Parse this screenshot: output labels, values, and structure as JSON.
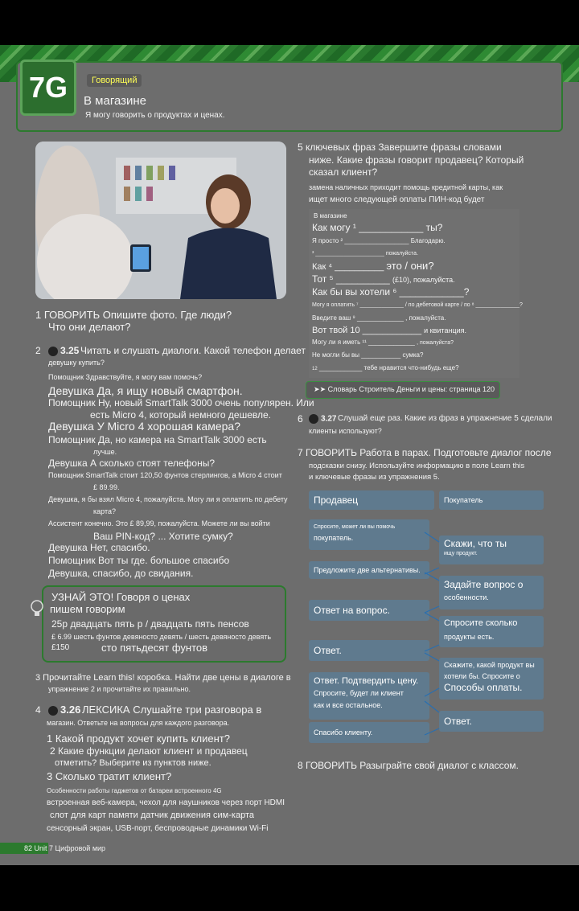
{
  "header": {
    "unit_tag": "7G",
    "speaking_tag": "Говорящий",
    "title": "В магазине",
    "subtitle": "Я могу говорить о продуктах и ценах."
  },
  "colors": {
    "green": "#2c7a2e",
    "box": "#5f7a8e",
    "yellow": "#ffff55"
  },
  "ex1": {
    "label": "1 ГОВОРИТЬ Опишите фото. Где люди?",
    "line2": "Что они делают?"
  },
  "ex2": {
    "label": "2",
    "audio": "3.25",
    "text": "Читать и слушать диалоги. Какой телефон делает",
    "line2": "девушку купить?",
    "dialogue": [
      {
        "text": "Помощник Здравствуйте, я могу вам помочь?",
        "size": "s"
      },
      {
        "text": "Девушка Да, я ищу новый смартфон.",
        "size": "b"
      },
      {
        "text": "Помощник Ну, новый SmartTalk 3000 очень популярен. Или",
        "size": "t"
      },
      {
        "text": "есть Micro 4, который немного дешевле.",
        "size": "t"
      },
      {
        "text": "Девушка У Micro 4 хорошая камера?",
        "size": "b"
      },
      {
        "text": "Помощник Да, но камера на SmartTalk 3000 есть",
        "size": "t"
      },
      {
        "text": "лучше.",
        "size": "s"
      },
      {
        "text": "Девушка А сколько стоят телефоны?",
        "size": "t"
      },
      {
        "text": "Помощник SmartTalk стоит 120,50 фунтов стерлингов, а Micro 4 стоит",
        "size": "s"
      },
      {
        "text": "£ 89.99.",
        "size": "s"
      },
      {
        "text": "Девушка, я бы взял Micro 4, пожалуйста. Могу ли я оплатить по дебету",
        "size": "s"
      },
      {
        "text": "карта?",
        "size": "s"
      },
      {
        "text": "Ассистент конечно. Это £ 89,99, пожалуйста. Можете ли вы войти",
        "size": "s"
      },
      {
        "text": "Ваш PIN-код? ... Хотите сумку?",
        "size": "t"
      },
      {
        "text": "Девушка Нет, спасибо.",
        "size": "t"
      },
      {
        "text": "Помощник Вот ты где. большое спасибо",
        "size": "t"
      },
      {
        "text": "Девушка, спасибо, до свидания.",
        "size": "t"
      }
    ]
  },
  "know": {
    "title": "УЗНАЙ ЭТО! Говоря о ценах",
    "subtitle": "пишем говорим",
    "line1": "25p двадцать пять p / двадцать пять пенсов",
    "line2": "£ 6.99 шесть фунтов девяносто девять / шесть девяносто девять",
    "line3": "£150",
    "line4": "сто пятьдесят фунтов"
  },
  "ex3": {
    "text": "3 Прочитайте Learn this! коробка. Найти две цены в диалоге в",
    "line2": "упражнение 2 и прочитайте их правильно."
  },
  "ex4": {
    "label": "4",
    "audio": "3.26",
    "title": "ЛЕКСИКА Слушайте три разговора в",
    "line2": "магазин. Ответьте на вопросы для каждого разговора.",
    "q1": "1 Какой продукт хочет купить клиент?",
    "q2": "2 Какие функции делают клиент и продавец",
    "q2b": "отметить? Выберите из пунктов ниже.",
    "q3": "3 Сколько тратит клиент?",
    "features1": "Особенности работы гаджетов от батареи встроенного 4G",
    "features2": "встроенная веб-камера, чехол для наушников через порт HDMI",
    "features3": "слот для карт памяти датчик движения сим-карта",
    "features4": "сенсорный экран, USB-порт, беспроводные динамики Wi-Fi"
  },
  "footer": {
    "page": "82 Unit 7 Цифровой мир"
  },
  "ex5": {
    "title": "5 ключевых фраз Завершите фразы словами",
    "line2": "ниже. Какие фразы говорит продавец? Который",
    "line3": "сказал клиент?",
    "words1": "замена наличных приходит помощь кредитной карты, как",
    "words2": "ищет много следующей оплаты ПИН-код будет",
    "form": {
      "heading": "В магазине",
      "l1": "Как могу",
      "l1b": "ты?",
      "l2": "Я просто",
      "l2b": "Благодарю.",
      "l3b": "пожалуйста.",
      "l4": "Как",
      "l4b": "это / они?",
      "l5": "Тот",
      "l5b": "(£10), пожалуйста.",
      "l6": "Как бы вы хотели",
      "l7": "Могу я оплатить",
      "l7b": "/ по дебетовой карте / по",
      "l8": "Введите ваш",
      "l8b": ", пожалуйста.",
      "l9": "Вот твой 10",
      "l9b": "и квитанция.",
      "l10": "Могу ли я иметь",
      "l10b": ", пожалуйста?",
      "l11": "Не могли бы вы",
      "l11b": "сумка?",
      "l12": "12",
      "l12b": "тебе нравится что-нибудь еще?"
    }
  },
  "wordbuilder": {
    "text": "Словарь Строитель Деньги и цены: страница 120"
  },
  "ex6": {
    "label": "6",
    "audio": "3.27",
    "text": "Слушай еще раз. Какие из фраз в упражнение 5 сделали",
    "line2": "клиенты используют?"
  },
  "ex7": {
    "title": "7 ГОВОРИТЬ Работа в парах. Подготовьте диалог после",
    "line2": "подсказки снизу. Используйте информацию в поле Learn this",
    "line3": "и ключевые фразы из упражнения 5."
  },
  "flow": {
    "seller": "Продавец",
    "customer": "Покупатель",
    "a1": "Спросите, может ли вы помочь",
    "a1b": "покупатель.",
    "b1": "Скажи, что ты",
    "b1b": "ищу продукт.",
    "a2": "Предложите две альтернативы.",
    "b2": "Задайте вопрос о",
    "b2b": "особенности.",
    "a3": "Ответ на вопрос.",
    "b3": "Спросите сколько",
    "b3b": "продукты есть.",
    "a4": "Ответ.",
    "b4": "Скажите, какой продукт вы",
    "b4b": "хотели бы. Спросите о",
    "b4c": "Способы оплаты.",
    "a5": "Ответ. Подтвердить цену.",
    "a5b": "Спросите, будет ли клиент",
    "a5c": "как и все остальное.",
    "b5": "Ответ.",
    "a6": "Спасибо клиенту."
  },
  "ex8": {
    "text": "8 ГОВОРИТЬ Разыграйте свой диалог с классом."
  }
}
